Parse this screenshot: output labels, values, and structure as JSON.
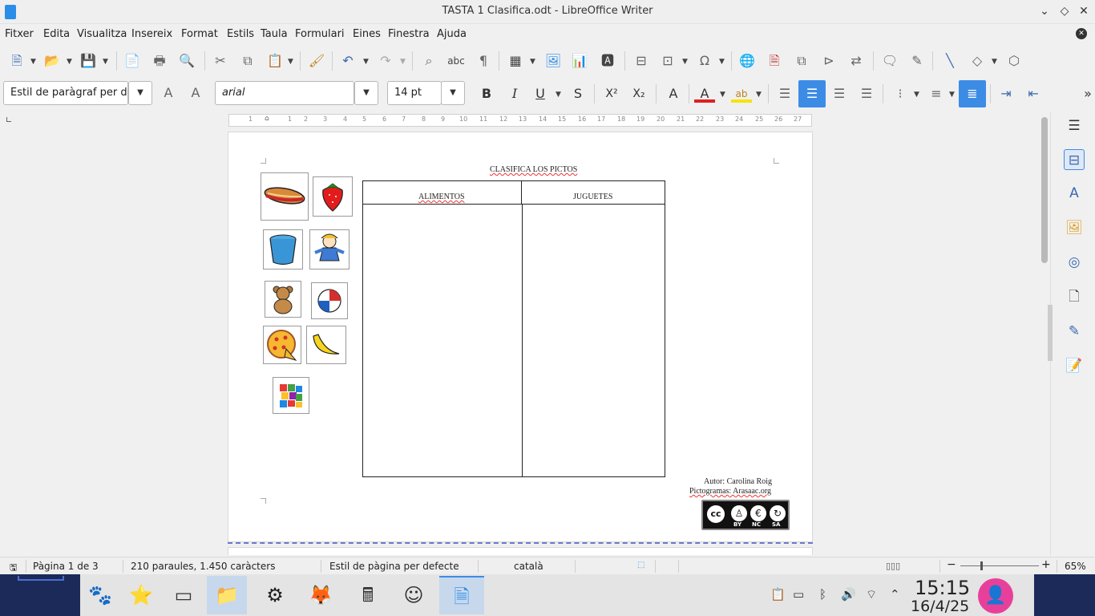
{
  "window": {
    "title": "TASTA 1 Clasifica.odt - LibreOffice Writer"
  },
  "menu": [
    "Fitxer",
    "Edita",
    "Visualitza",
    "Insereix",
    "Format",
    "Estils",
    "Taula",
    "Formulari",
    "Eines",
    "Finestra",
    "Ajuda"
  ],
  "format_bar": {
    "paragraph_style": "Estil de paràgraf per de",
    "font_name": "arial",
    "font_size": "14 pt",
    "bold": "B",
    "italic": "I",
    "underline": "U",
    "strike": "S"
  },
  "ruler_ticks": [
    "1",
    "1",
    "2",
    "3",
    "4",
    "5",
    "6",
    "7",
    "8",
    "9",
    "10",
    "11",
    "12",
    "13",
    "14",
    "15",
    "16",
    "17",
    "18",
    "19",
    "20",
    "21",
    "22",
    "23",
    "24",
    "25",
    "26",
    "27"
  ],
  "document": {
    "heading": "CLASIFICA LOS PICTOS",
    "col_left": "ALIMENTOS",
    "col_right": "JUGUETES",
    "author": "Autor: Carolina Roig",
    "pictograms": "Pictogramas: Arasaac.org",
    "license": {
      "cc": "cc",
      "by": "BY",
      "nc": "NC",
      "sa": "SA"
    },
    "pictos": [
      "sandwich",
      "strawberry",
      "bucket",
      "doll",
      "teddy-bear",
      "beach-ball",
      "pizza",
      "banana",
      "puzzle"
    ]
  },
  "status": {
    "page": "Pàgina 1 de 3",
    "words": "210 paraules, 1.450 caràcters",
    "page_style": "Estil de pàgina per defecte",
    "language": "català",
    "zoom": "65%",
    "zoom_level": 0.65
  },
  "taskbar": {
    "time": "15:15",
    "date": "16/4/25"
  },
  "colors": {
    "accent": "#3c8ce6",
    "font_color": "#e02020",
    "highlight": "#f5e400",
    "avatar": "#e8409a"
  }
}
